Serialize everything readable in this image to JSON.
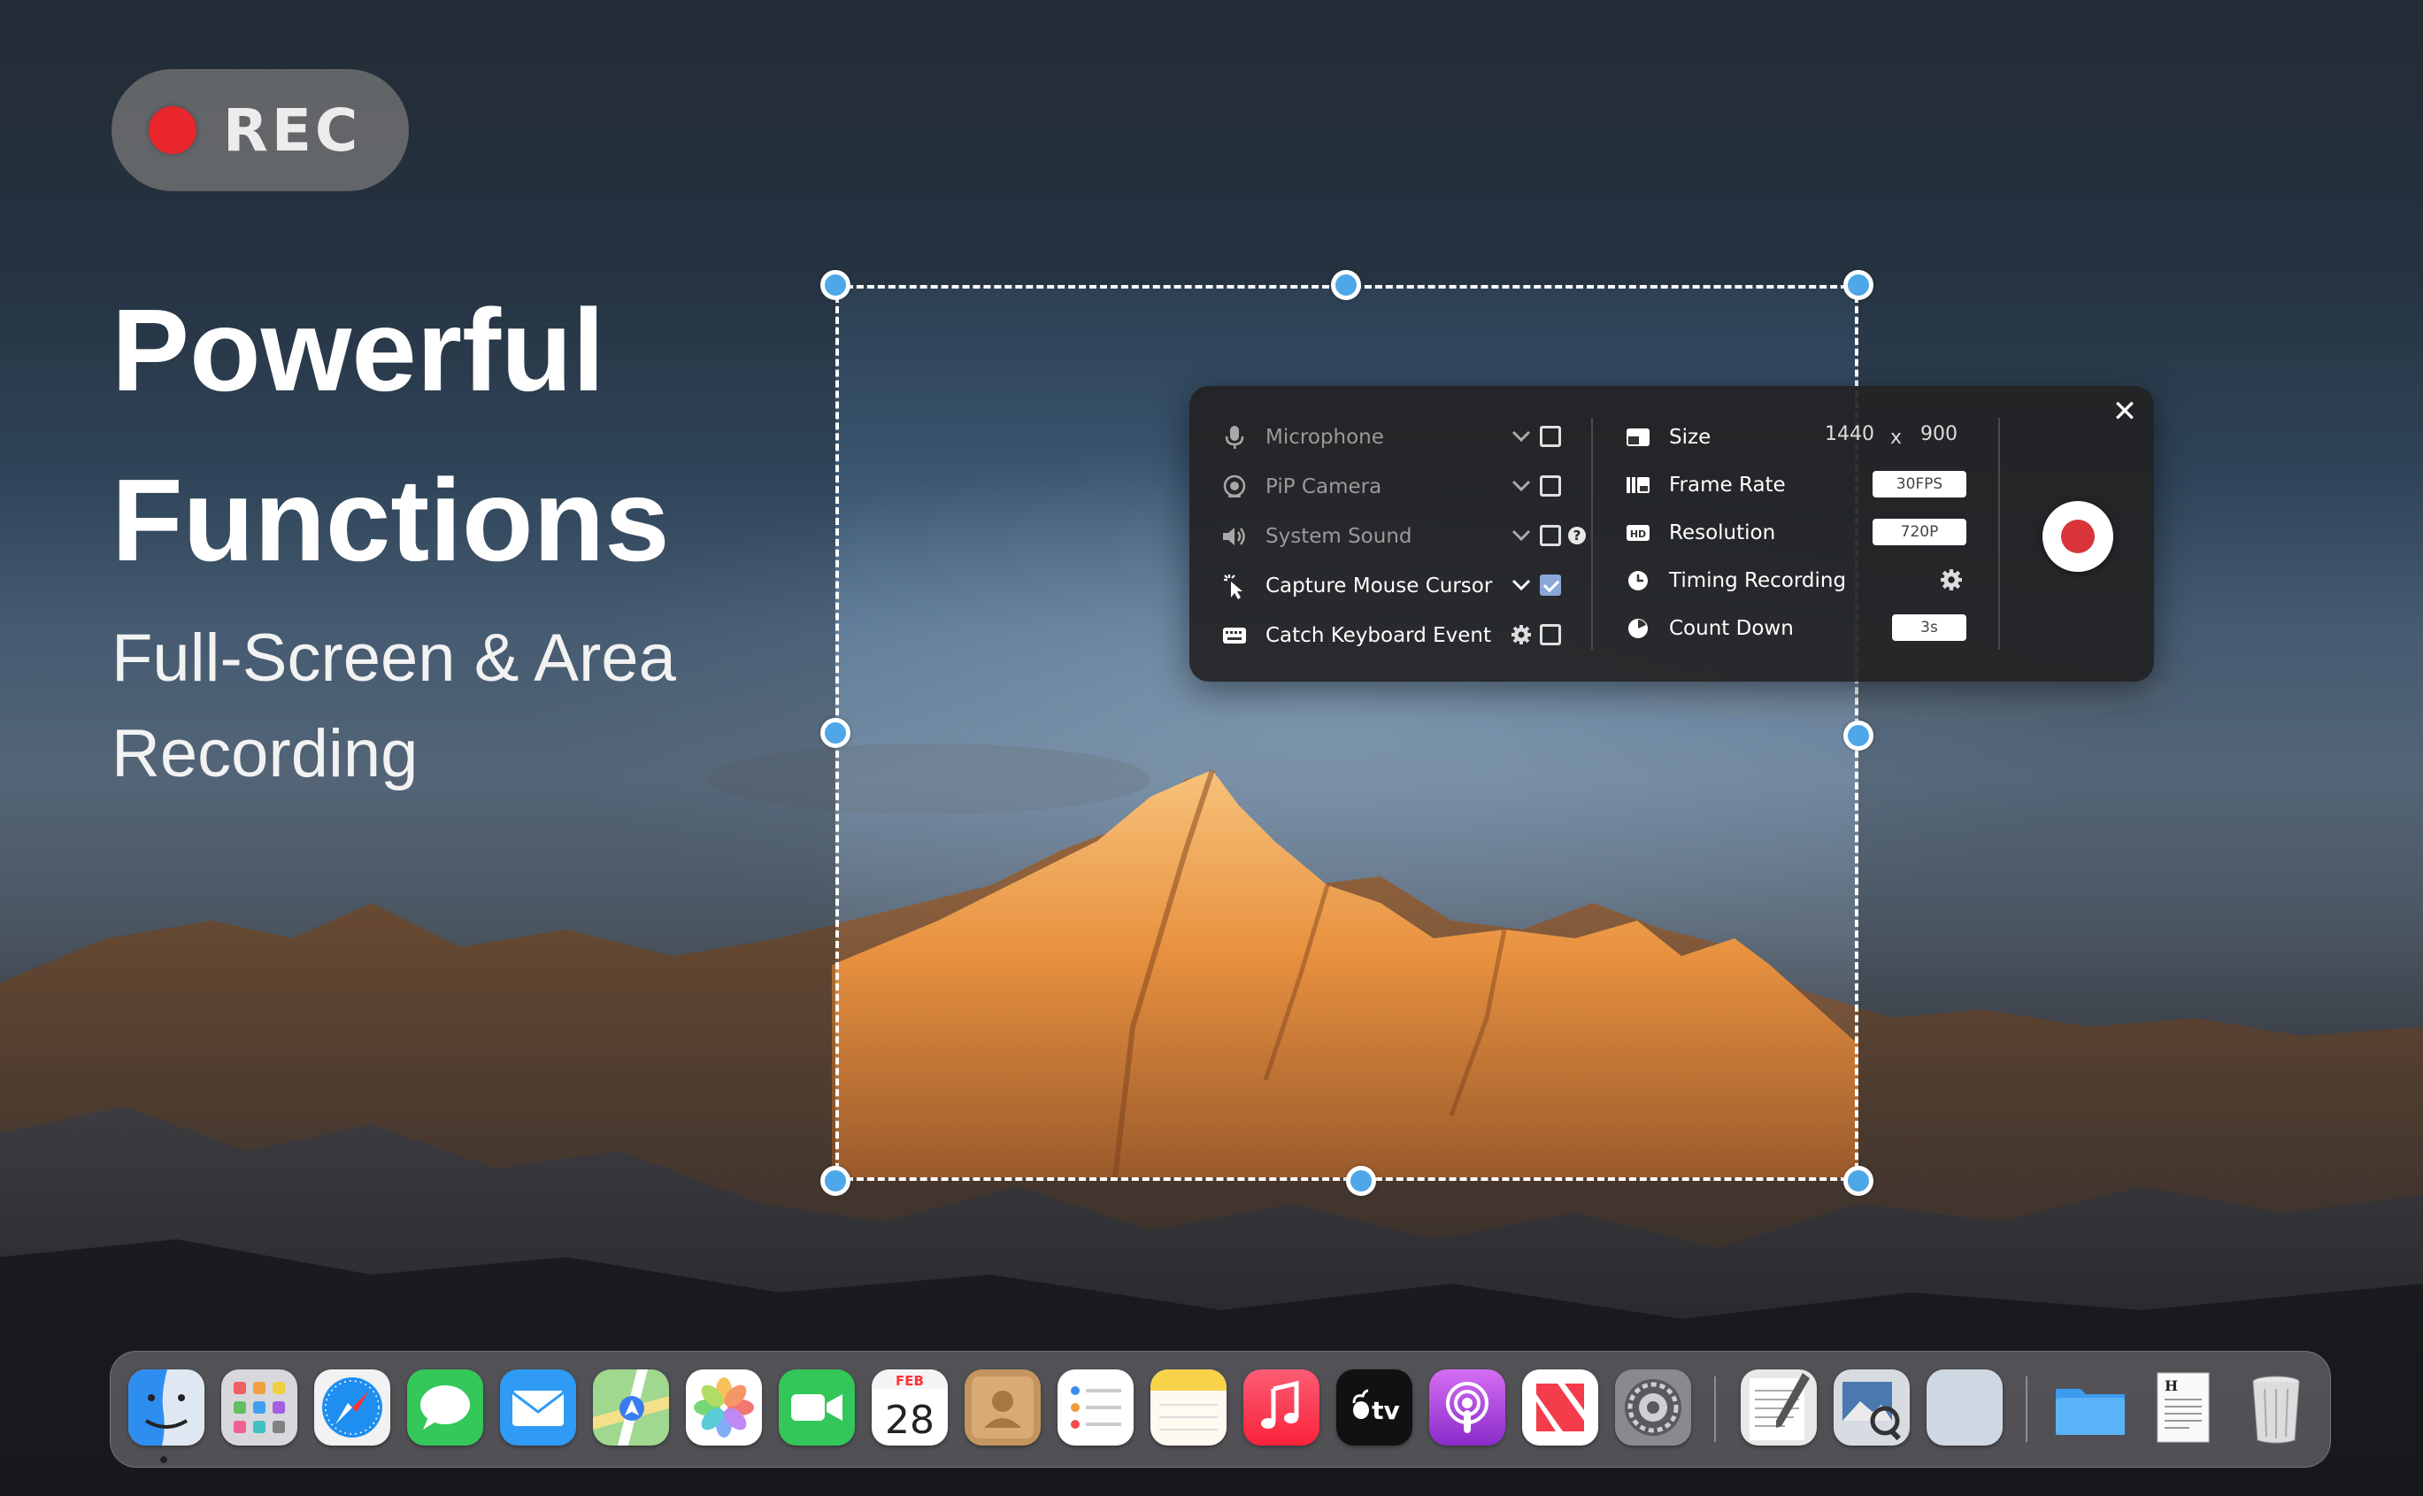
{
  "rec_badge": {
    "label": "REC"
  },
  "headline": {
    "line1": "Powerful",
    "line2": "Functions",
    "sub1": "Full-Screen & Area",
    "sub2": "Recording"
  },
  "panel": {
    "left_options": [
      {
        "label": "Microphone",
        "icon": "microphone-icon",
        "enabled": false,
        "has_dropdown": true,
        "checked": false
      },
      {
        "label": "PiP Camera",
        "icon": "camera-icon",
        "enabled": false,
        "has_dropdown": true,
        "checked": false
      },
      {
        "label": "System Sound",
        "icon": "speaker-icon",
        "enabled": false,
        "has_dropdown": true,
        "checked": false,
        "help": "?"
      },
      {
        "label": "Capture Mouse Cursor",
        "icon": "cursor-click-icon",
        "enabled": true,
        "has_dropdown": true,
        "checked": true
      },
      {
        "label": "Catch Keyboard Event",
        "icon": "keyboard-icon",
        "enabled": true,
        "has_settings": true,
        "checked": false
      }
    ],
    "right_options": {
      "size": {
        "label": "Size",
        "width": "1440",
        "separator": "x",
        "height": "900"
      },
      "frame_rate": {
        "label": "Frame Rate",
        "value": "30FPS"
      },
      "resolution": {
        "label": "Resolution",
        "value": "720P"
      },
      "timing": {
        "label": "Timing Recording"
      },
      "countdown": {
        "label": "Count Down",
        "value": "3s"
      }
    },
    "close_symbol": "✕",
    "accent_record": "#d8343a",
    "checkbox_checked_color": "#8aa6d8"
  },
  "selection": {
    "handle_color": "#4ea7e8"
  },
  "dock": {
    "apps": [
      "Finder",
      "Launchpad",
      "Safari",
      "Messages",
      "Mail",
      "Maps",
      "Photos",
      "FaceTime",
      "Calendar",
      "Contacts",
      "Reminders",
      "Notes",
      "Music",
      "TV",
      "Podcasts",
      "News",
      "System Preferences",
      "TextEdit",
      "Preview",
      "Blank App",
      "Folder",
      "Document",
      "Trash"
    ],
    "calendar_month": "FEB",
    "calendar_day": "28",
    "tv_label": "tv"
  }
}
